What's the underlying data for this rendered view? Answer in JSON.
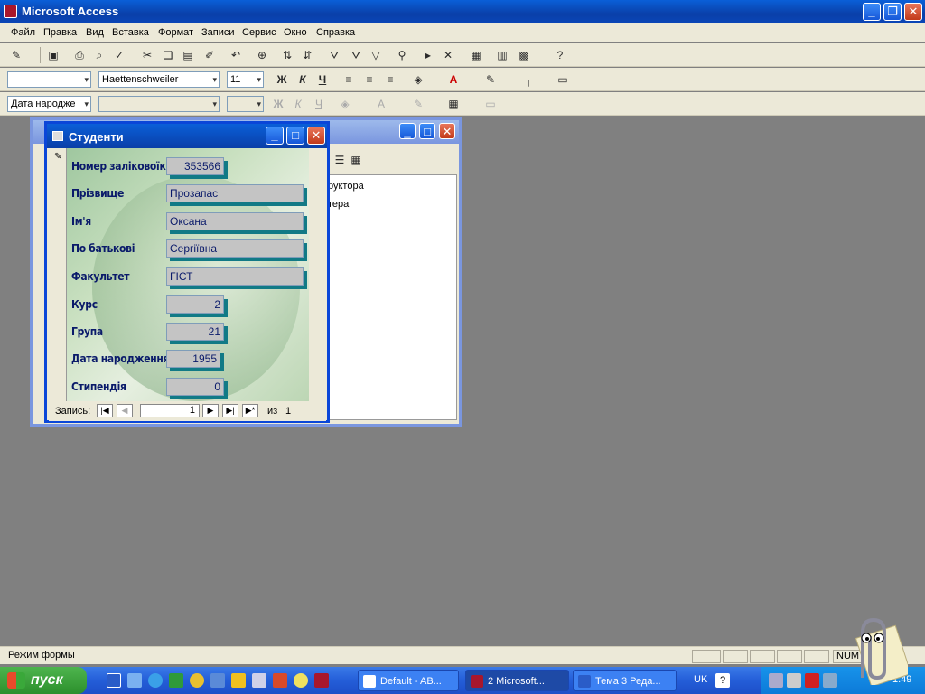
{
  "app_title": "Microsoft Access",
  "menu": [
    "Файл",
    "Правка",
    "Вид",
    "Вставка",
    "Формат",
    "Записи",
    "Сервис",
    "Окно",
    "Справка"
  ],
  "format_bar": {
    "font": "Haettenschweiler",
    "size": "11"
  },
  "field_selector": "Дата народже",
  "db_window": {
    "items": [
      "руктора",
      "тера"
    ]
  },
  "form": {
    "title": "Студенти",
    "fields": [
      {
        "label": "Номер заліковоїкн",
        "value": "353566",
        "numeric": true
      },
      {
        "label": "Прізвище",
        "value": "Прозапас",
        "numeric": false
      },
      {
        "label": "Ім'я",
        "value": "Оксана",
        "numeric": false
      },
      {
        "label": "По батькові",
        "value": "Сергіївна",
        "numeric": false
      },
      {
        "label": "Факультет",
        "value": "ГІСТ",
        "numeric": false
      },
      {
        "label": "Курс",
        "value": "2",
        "numeric": true
      },
      {
        "label": "Група",
        "value": "21",
        "numeric": true
      },
      {
        "label": "Дата народження",
        "value": "1955",
        "numeric": true
      },
      {
        "label": "Стипендія",
        "value": "0",
        "numeric": true
      }
    ],
    "nav": {
      "label": "Запись:",
      "current": "1",
      "of_label": "из",
      "total": "1"
    }
  },
  "status": {
    "text": "Режим формы",
    "num": "NUM"
  },
  "taskbar": {
    "start": "пуск",
    "tasks": [
      "Default - AB...",
      "2 Microsoft...",
      "Тема 3 Реда..."
    ],
    "lang": "UK",
    "clock": "1:49"
  }
}
